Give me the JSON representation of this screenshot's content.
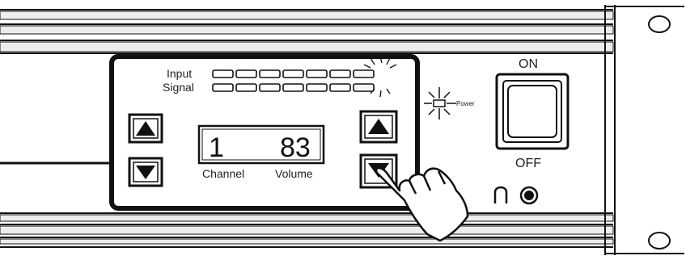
{
  "meter": {
    "label_top": "Input",
    "label_bottom": "Signal",
    "segments_per_row": 7,
    "lit_segment_index": 6
  },
  "display": {
    "channel": "1",
    "volume": "83",
    "channel_label": "Channel",
    "volume_label": "Volume"
  },
  "power_led_label": "Power",
  "power_switch": {
    "on_label": "ON",
    "off_label": "OFF"
  },
  "icons": {
    "channel_up": "triangle-up-icon",
    "channel_down": "triangle-down-icon",
    "volume_up": "triangle-up-icon",
    "volume_down": "triangle-down-icon",
    "headphone": "headphone-icon",
    "hand": "pointing-hand-icon",
    "led_burst": "light-burst-icon"
  },
  "colors": {
    "ink": "#111111",
    "panel": "#ffffff",
    "shade": "#e9e9e9"
  }
}
